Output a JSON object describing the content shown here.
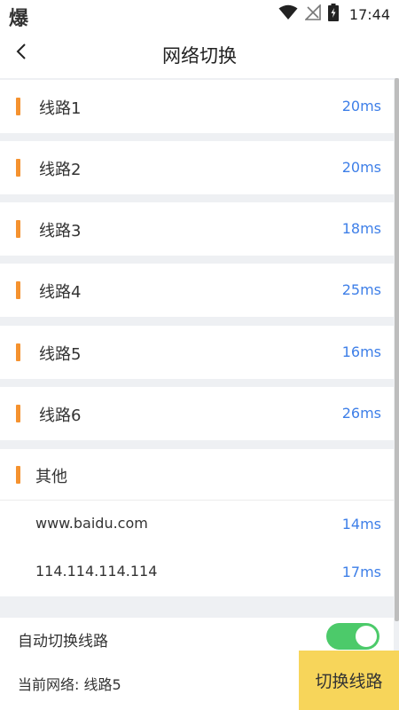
{
  "status_bar": {
    "app_icon_text": "爆",
    "time": "17:44"
  },
  "header": {
    "title": "网络切换"
  },
  "lines": [
    {
      "label": "线路1",
      "latency": "20ms"
    },
    {
      "label": "线路2",
      "latency": "20ms"
    },
    {
      "label": "线路3",
      "latency": "18ms"
    },
    {
      "label": "线路4",
      "latency": "25ms"
    },
    {
      "label": "线路5",
      "latency": "16ms"
    },
    {
      "label": "线路6",
      "latency": "26ms"
    }
  ],
  "other": {
    "title": "其他",
    "items": [
      {
        "name": "www.baidu.com",
        "latency": "14ms"
      },
      {
        "name": "114.114.114.114",
        "latency": "17ms"
      }
    ]
  },
  "auto_switch": {
    "label": "自动切换线路",
    "enabled": true
  },
  "footer": {
    "current_network": "当前网络: 线路5",
    "switch_button": "切换线路"
  },
  "colors": {
    "accent": "#f5922f",
    "latency": "#3e7fe8",
    "button": "#f7d55a",
    "toggle_on": "#4cca6a"
  },
  "icons": [
    "wifi-icon",
    "signal-icon",
    "battery-icon",
    "back-arrow-icon"
  ]
}
